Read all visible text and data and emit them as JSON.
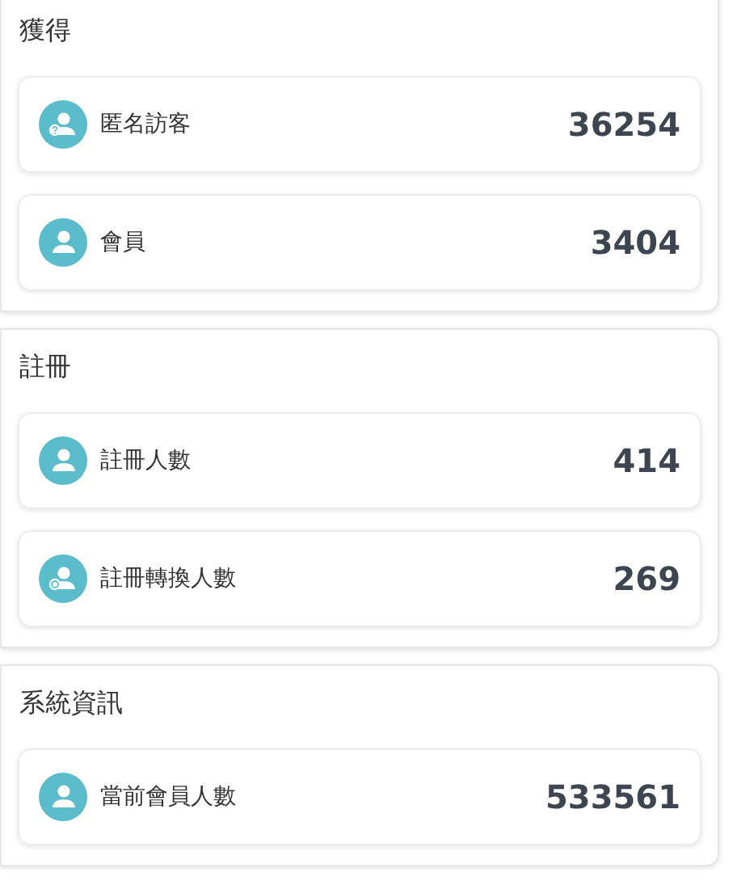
{
  "sections": [
    {
      "title": "獲得",
      "items": [
        {
          "kind": "question",
          "label": "匿名訪客",
          "value": "36254"
        },
        {
          "kind": "plain",
          "label": "會員",
          "value": "3404"
        }
      ]
    },
    {
      "title": "註冊",
      "items": [
        {
          "kind": "plain",
          "label": "註冊人數",
          "value": "414"
        },
        {
          "kind": "coin",
          "label": "註冊轉換人數",
          "value": "269"
        }
      ]
    },
    {
      "title": "系統資訊",
      "items": [
        {
          "kind": "plain",
          "label": "當前會員人數",
          "value": "533561"
        }
      ]
    }
  ]
}
